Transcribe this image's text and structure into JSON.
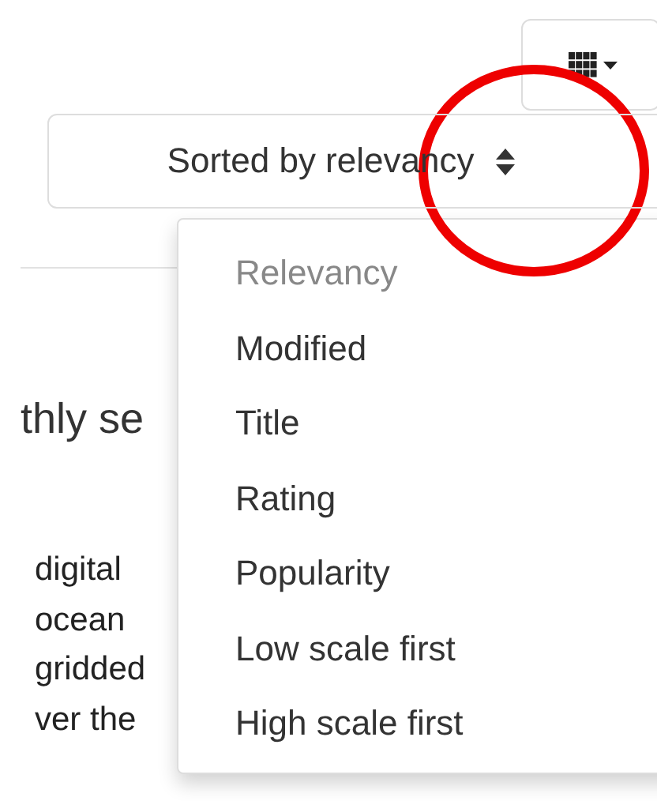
{
  "view_button": {
    "kind": "grid"
  },
  "sort_button": {
    "label": "Sorted by relevancy"
  },
  "heading": "thly se",
  "paragraph_lines": [
    "digital",
    "ocean",
    "gridded",
    "ver the"
  ],
  "sort_menu": {
    "items": [
      {
        "label": "Relevancy",
        "selected": true
      },
      {
        "label": "Modified",
        "selected": false
      },
      {
        "label": "Title",
        "selected": false
      },
      {
        "label": "Rating",
        "selected": false
      },
      {
        "label": "Popularity",
        "selected": false
      },
      {
        "label": "Low scale first",
        "selected": false
      },
      {
        "label": "High scale first",
        "selected": false
      }
    ]
  }
}
